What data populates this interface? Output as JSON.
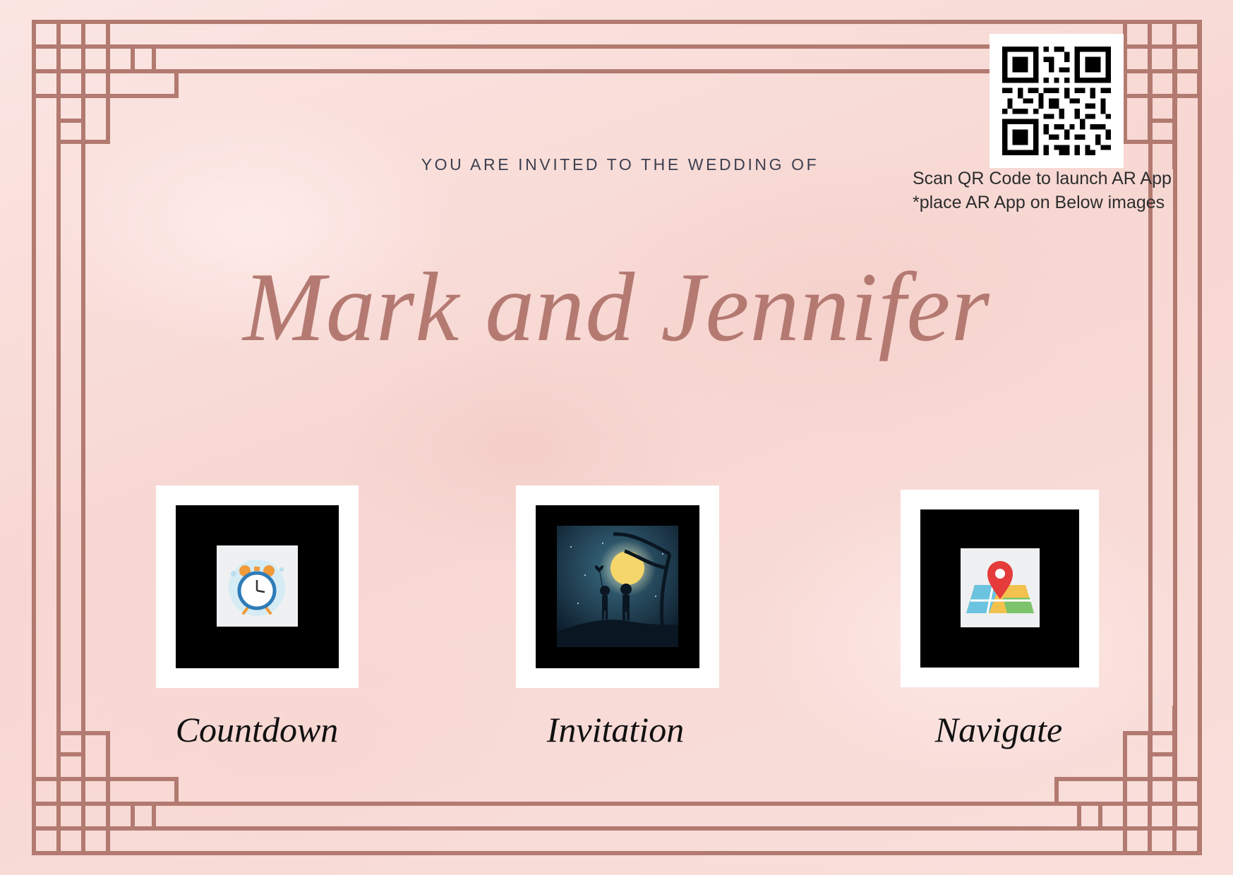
{
  "invitation": {
    "header": "YOU ARE INVITED TO THE WEDDING OF",
    "couple_names": "Mark and Jennifer"
  },
  "qr": {
    "caption_line1": "Scan QR Code to launch AR App",
    "caption_line2": "*place AR App on Below images"
  },
  "cards": [
    {
      "label": "Countdown",
      "icon": "alarm-clock-icon"
    },
    {
      "label": "Invitation",
      "icon": "couple-under-moon-illustration"
    },
    {
      "label": "Navigate",
      "icon": "map-pin-icon"
    }
  ],
  "colors": {
    "frame": "#b27a70",
    "background": "#f8dedb",
    "names": "#b47a72",
    "header_text": "#3c3f4f"
  }
}
